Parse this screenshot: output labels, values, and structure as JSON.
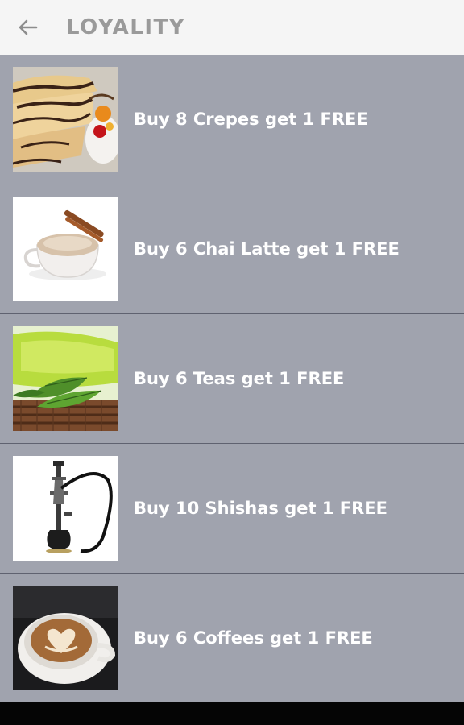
{
  "header": {
    "title": "LOYALITY",
    "back_icon": "arrow-left-icon"
  },
  "colors": {
    "header_bg": "#f5f5f5",
    "title_color": "#9a9a9a",
    "list_bg": "#a0a3ae",
    "divider": "#5f6270",
    "text": "#ffffff"
  },
  "items": [
    {
      "label": "Buy 8 Crepes get 1 FREE",
      "image": "crepes-image"
    },
    {
      "label": "Buy 6 Chai Latte get 1 FREE",
      "image": "chai-latte-image"
    },
    {
      "label": "Buy 6 Teas get 1 FREE",
      "image": "tea-image"
    },
    {
      "label": "Buy 10 Shishas get 1 FREE",
      "image": "shisha-image"
    },
    {
      "label": "Buy 6 Coffees get 1 FREE",
      "image": "coffee-image"
    }
  ]
}
